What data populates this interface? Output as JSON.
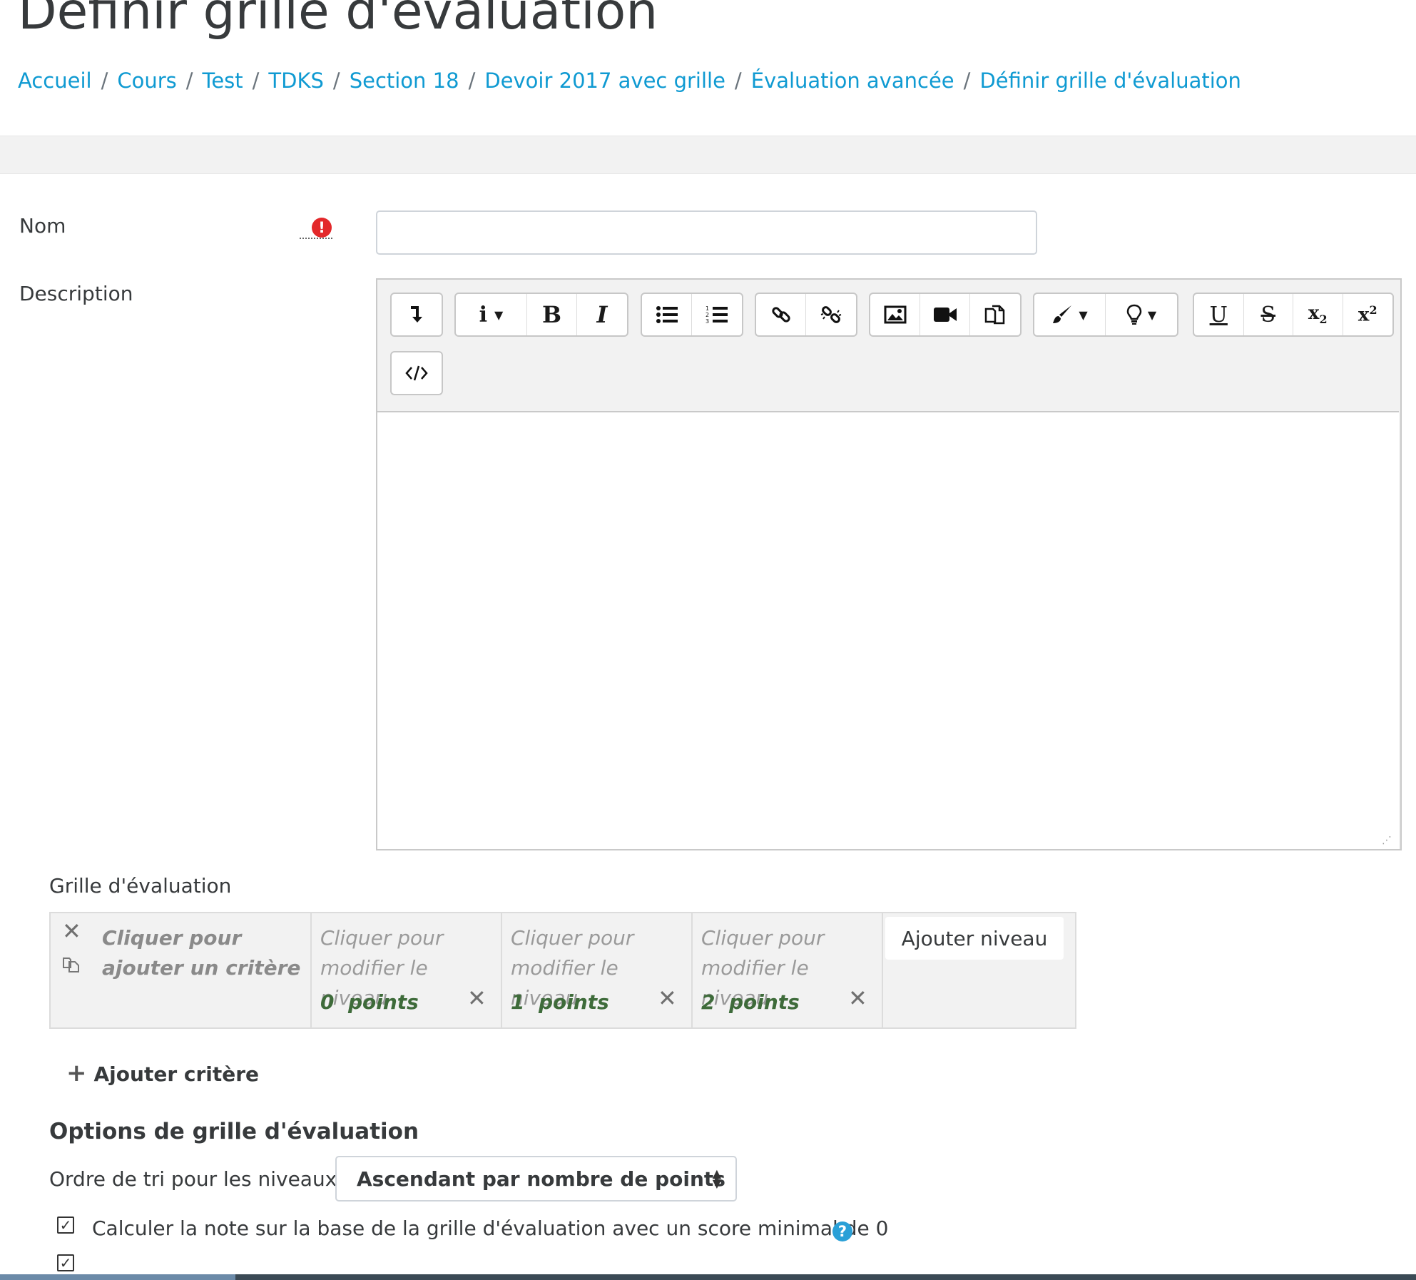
{
  "page": {
    "title": "Définir grille d'évaluation",
    "breadcrumb": [
      "Accueil",
      "Cours",
      "Test",
      "TDKS",
      "Section 18",
      "Devoir 2017 avec grille",
      "Évaluation avancée",
      "Définir grille d'évaluation"
    ],
    "breadcrumb_separator": "/"
  },
  "form": {
    "name_label": "Nom",
    "required_icon": "!",
    "name_value": "",
    "description_label": "Description"
  },
  "editor": {
    "toolbar_icons": [
      "collapse-icon",
      "paragraph-style-icon",
      "bold-icon",
      "italic-icon",
      "bulleted-list-icon",
      "numbered-list-icon",
      "link-icon",
      "unlink-icon",
      "image-icon",
      "video-icon",
      "manage-files-icon",
      "text-color-icon",
      "accessibility-icon",
      "underline-icon",
      "strikethrough-icon",
      "subscript-icon",
      "superscript-icon",
      "html-icon"
    ],
    "content": ""
  },
  "rubric": {
    "label": "Grille d'évaluation",
    "criterion_placeholder": "Cliquer pour ajouter un critère",
    "levels": [
      {
        "text": "Cliquer pour modifier le niveau",
        "points": "0",
        "unit": "points"
      },
      {
        "text": "Cliquer pour modifier le niveau",
        "points": "1",
        "unit": "points"
      },
      {
        "text": "Cliquer pour modifier le niveau",
        "points": "2",
        "unit": "points"
      }
    ],
    "add_level_label": "Ajouter niveau",
    "add_criterion_label": "Ajouter critère"
  },
  "options": {
    "title": "Options de grille d'évaluation",
    "sort_label": "Ordre de tri pour les niveaux :",
    "sort_value": "Ascendant par nombre de points",
    "checkbox1_label": "Calculer la note sur la base de la grille d'évaluation avec un score minimal de 0",
    "checkbox1_checked": true,
    "checkbox2_checked": true
  },
  "colors": {
    "link": "#0f9ad2",
    "required": "#e3282a",
    "help": "#2aa0d7",
    "points": "#3e6b3a"
  }
}
